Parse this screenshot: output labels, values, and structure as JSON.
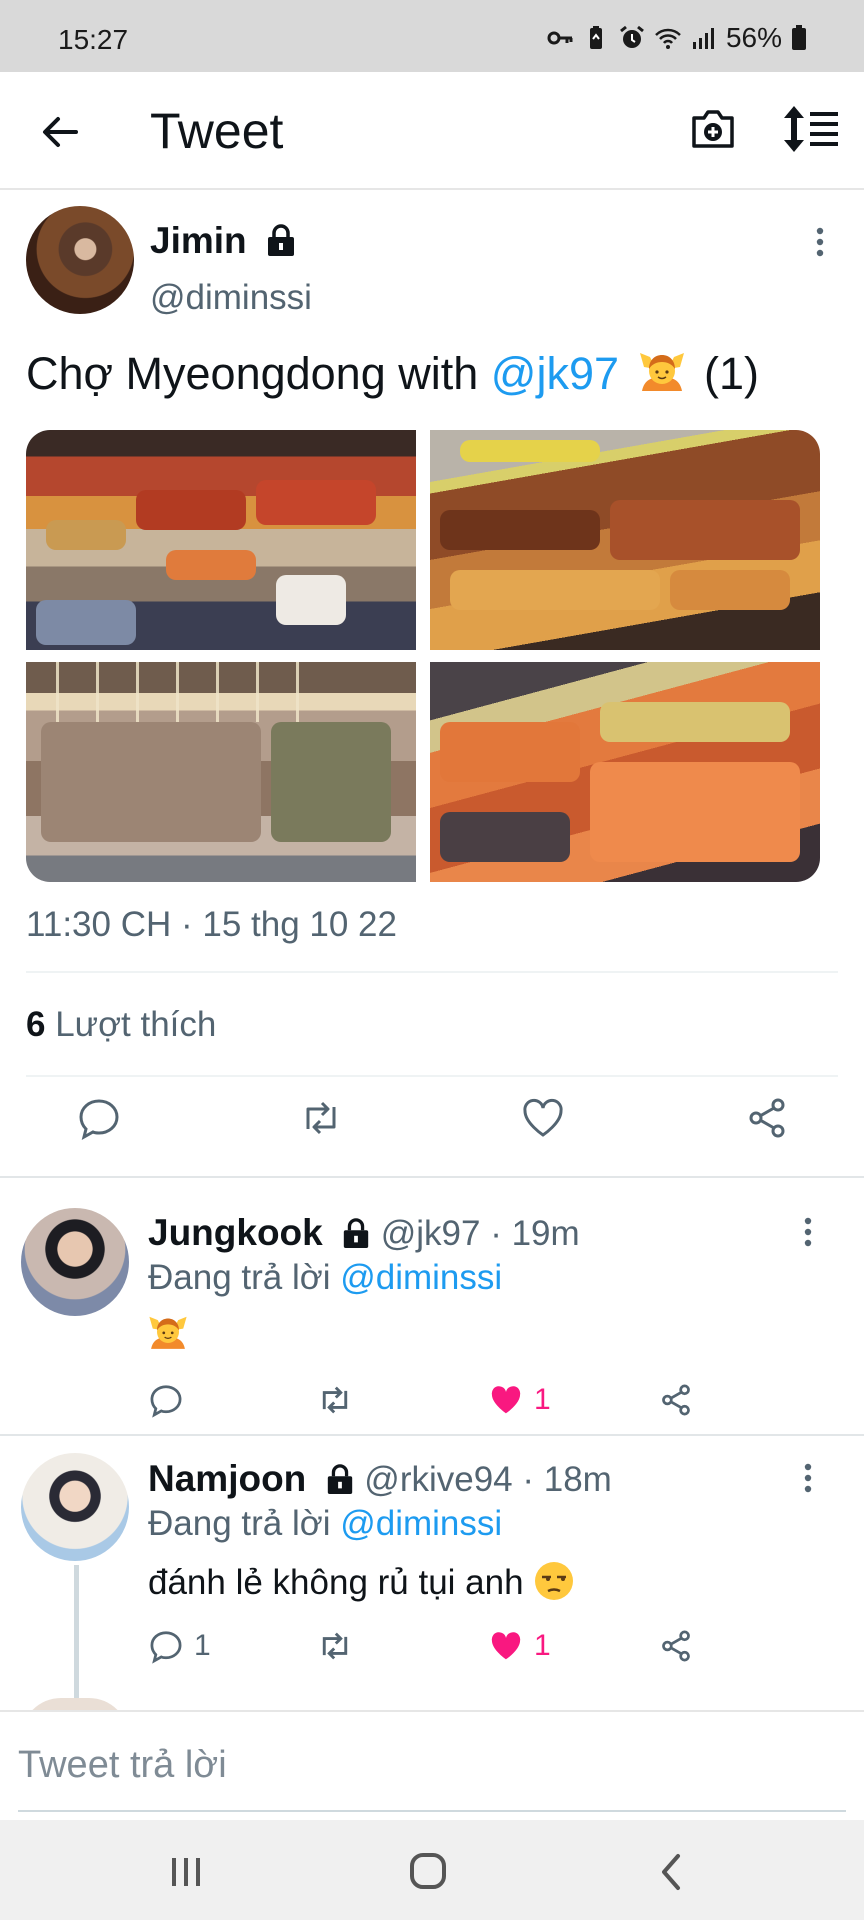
{
  "status_bar": {
    "time": "15:27",
    "battery": "56%",
    "icons": [
      "key-icon",
      "battery-saver-icon",
      "alarm-icon",
      "wifi-icon",
      "signal-icon",
      "battery-icon"
    ]
  },
  "app_bar": {
    "title": "Tweet",
    "icons": [
      "back-arrow-icon",
      "camera-add-icon",
      "sort-icon"
    ]
  },
  "tweet": {
    "author_name": "Jimin",
    "author_handle": "@diminssi",
    "text_before": "Chợ Myeongdong with ",
    "mention": "@jk97",
    "text_after": " (1)",
    "emoji": "person-gesturing-ok-emoji",
    "timestamp": "11:30 CH · 15 thg 10 22",
    "likes_count": "6",
    "likes_label": " Lượt thích",
    "actions": [
      "reply-icon",
      "retweet-icon",
      "like-icon",
      "share-icon"
    ],
    "photos": [
      "street-food-stall-photo",
      "grilled-skewers-photo",
      "seafood-skewers-photo",
      "sausage-grill-photo"
    ]
  },
  "replies": [
    {
      "name": "Jungkook",
      "meta": " @jk97 · 19m",
      "replying_prefix": "Đang trả lời ",
      "replying_to": "@diminssi",
      "text": "",
      "reply_count": "",
      "like_count": "1"
    },
    {
      "name": "Namjoon",
      "meta": " @rkive94 · 18m",
      "replying_prefix": "Đang trả lời ",
      "replying_to": "@diminssi",
      "text": "đánh lẻ không rủ tụi anh",
      "reply_count": "1",
      "like_count": "1"
    }
  ],
  "composer": {
    "placeholder": "Tweet trả lời"
  },
  "colors": {
    "accent": "#1d9bf0",
    "like": "#f91880",
    "secondary_text": "#536471"
  }
}
